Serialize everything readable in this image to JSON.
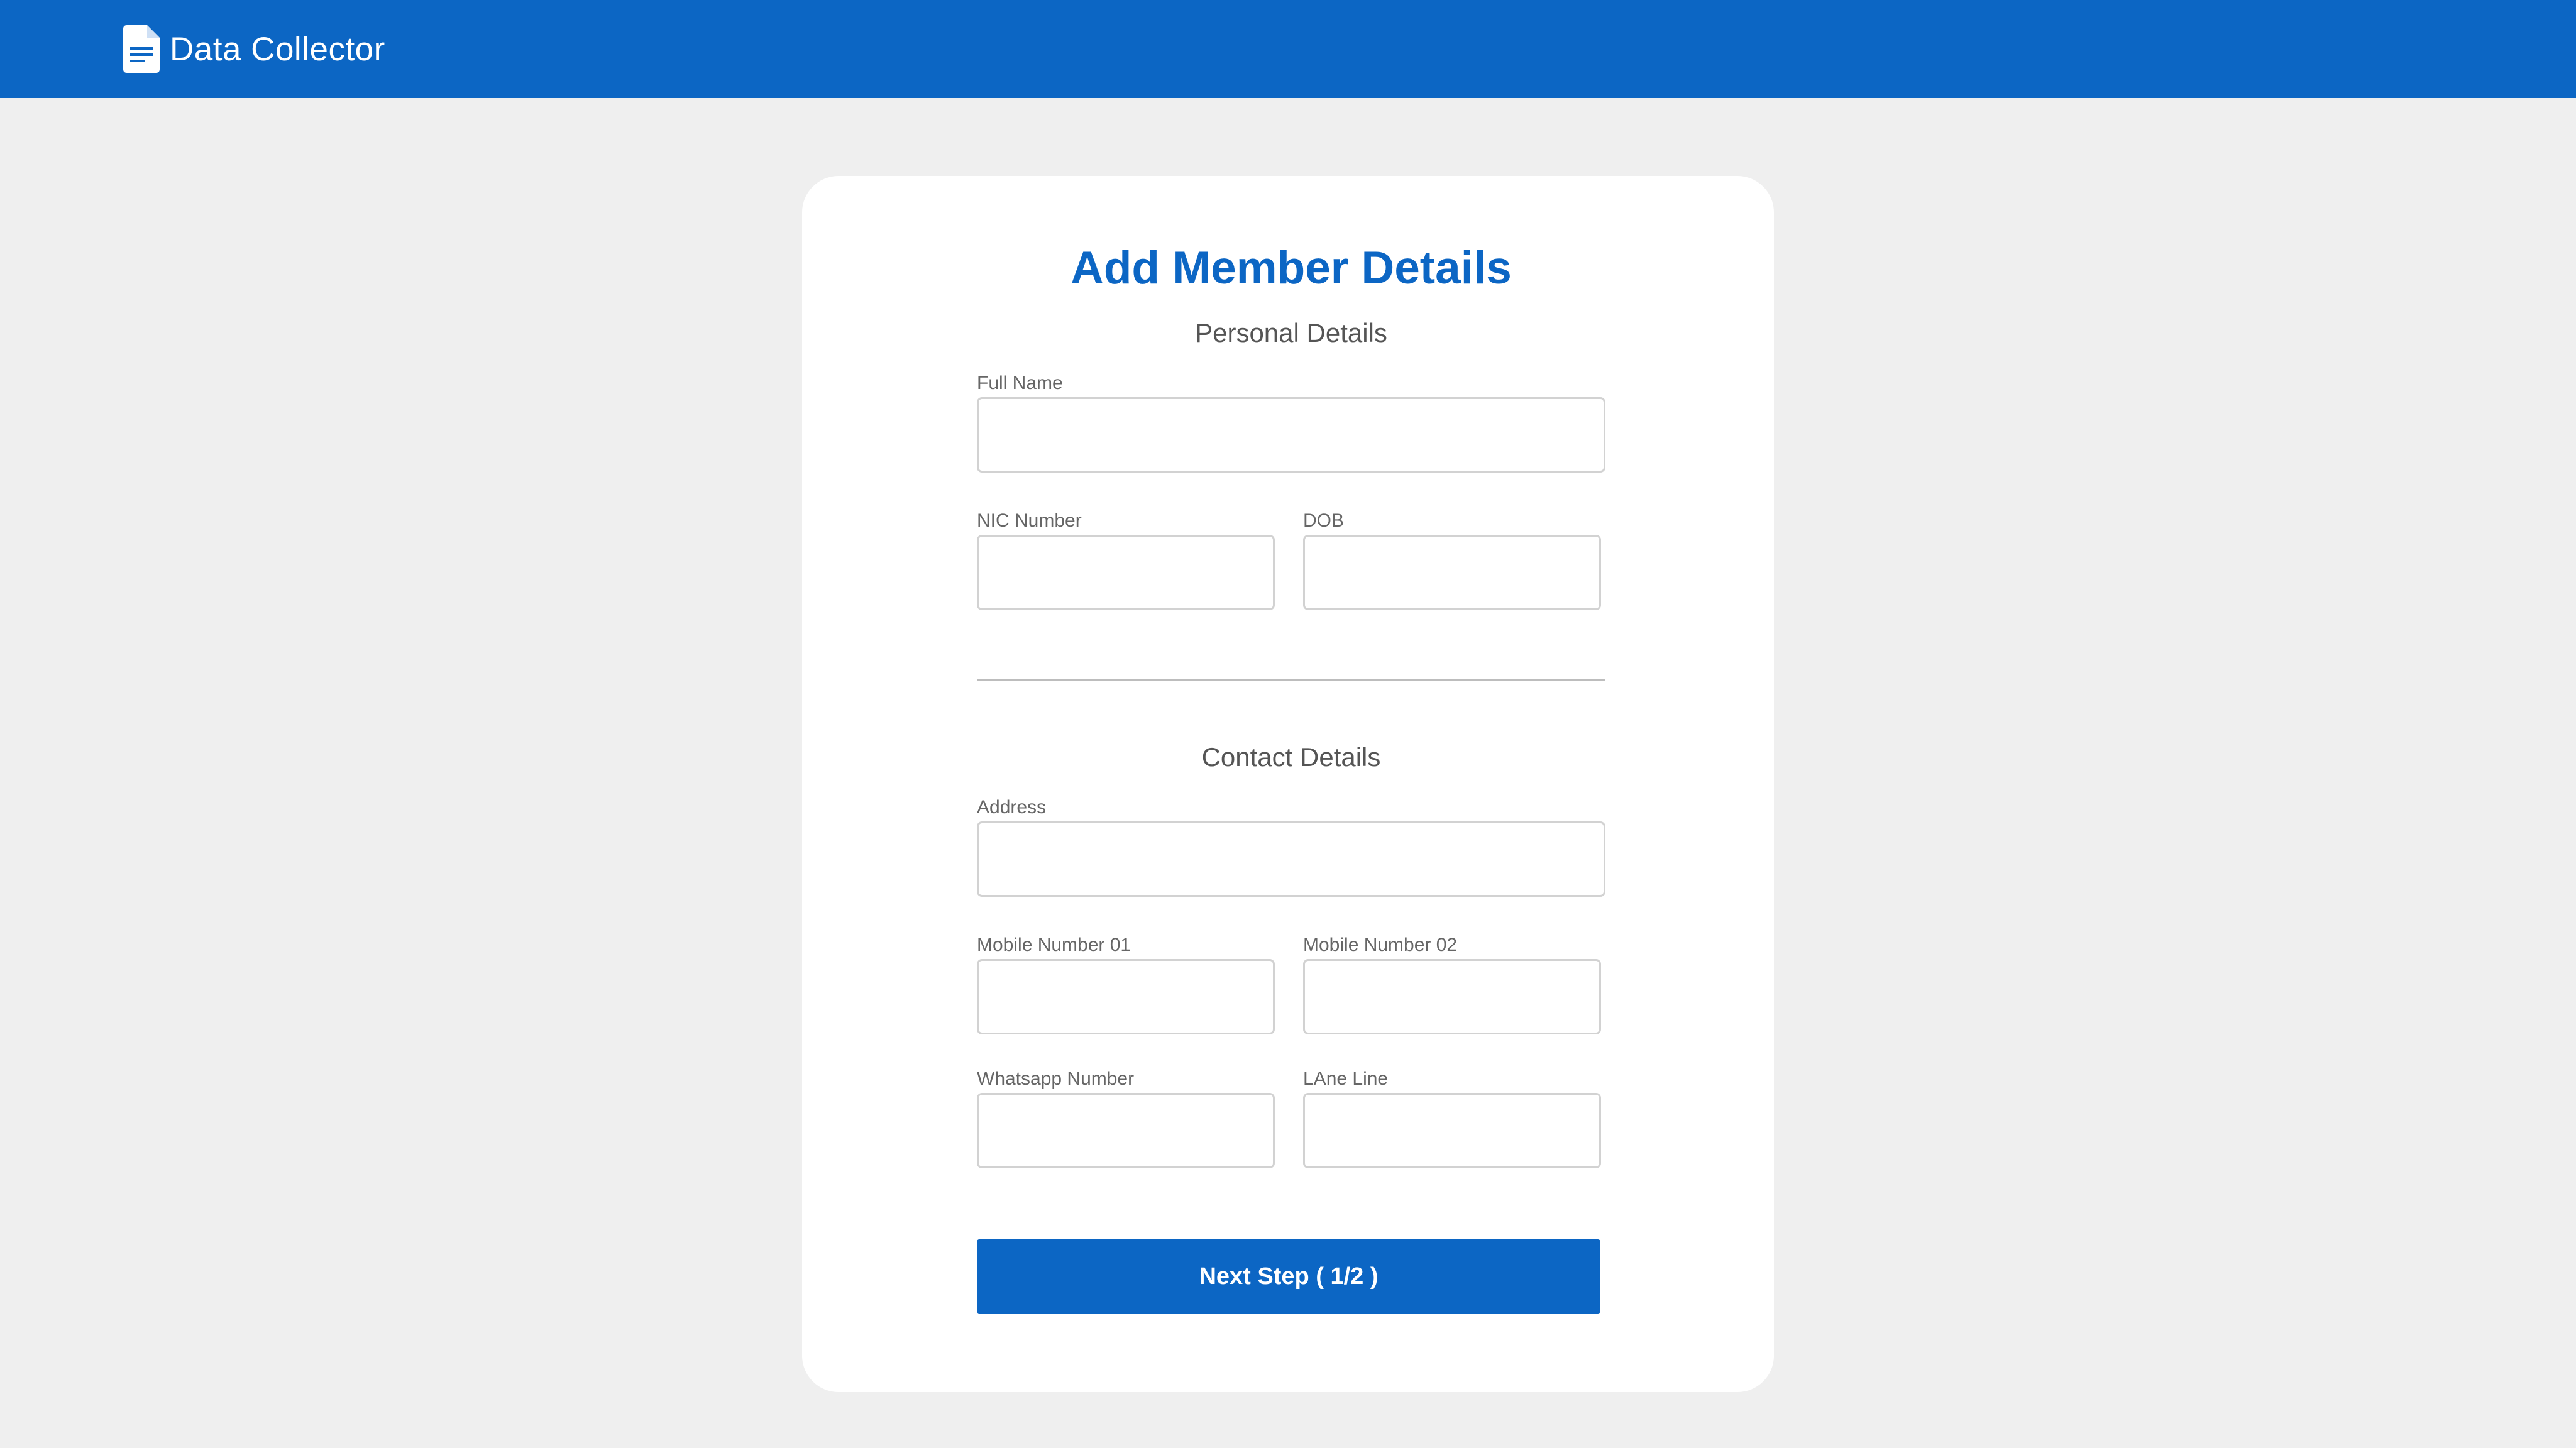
{
  "app": {
    "name": "Data Collector",
    "icon": "document-icon"
  },
  "colors": {
    "brand": "#0c66c4",
    "background": "#efefef",
    "card": "#ffffff"
  },
  "form": {
    "title": "Add Member Details",
    "personal": {
      "heading": "Personal Details",
      "full_name": {
        "label": "Full Name",
        "value": "",
        "placeholder": ""
      },
      "nic_number": {
        "label": "NIC Number",
        "value": "",
        "placeholder": ""
      },
      "dob": {
        "label": "DOB",
        "value": "",
        "placeholder": ""
      }
    },
    "contact": {
      "heading": "Contact Details",
      "address": {
        "label": "Address",
        "value": "",
        "placeholder": ""
      },
      "mobile_01": {
        "label": "Mobile Number 01",
        "value": "",
        "placeholder": ""
      },
      "mobile_02": {
        "label": "Mobile Number 02",
        "value": "",
        "placeholder": ""
      },
      "whatsapp": {
        "label": "Whatsapp Number",
        "value": "",
        "placeholder": ""
      },
      "land_line": {
        "label": "LAne Line",
        "value": "",
        "placeholder": ""
      }
    },
    "next_button_label": "Next Step ( 1/2 )"
  }
}
